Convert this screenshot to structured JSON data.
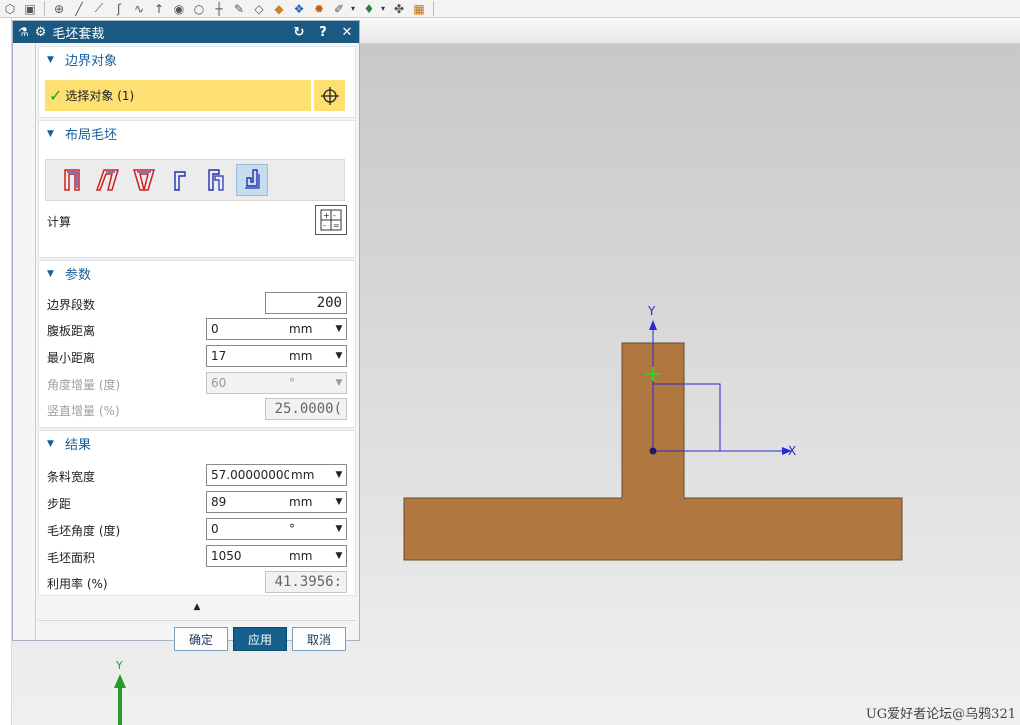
{
  "toolbar": {
    "icons": [
      "cube-icon",
      "cube-icon",
      "crosshair-icon",
      "line-icon",
      "line-icon",
      "curve-icon",
      "curve-icon",
      "arrow-up-icon",
      "circle-target-icon",
      "circle-icon",
      "cross-icon",
      "pen-icon",
      "eraser-icon",
      "brush-icon",
      "layers-icon",
      "gear-icon",
      "ruler-icon",
      "chart-icon",
      "camera-icon",
      "layout-icon"
    ]
  },
  "dialog": {
    "title": "毛坯套裁",
    "boundary": {
      "header": "边界对象",
      "select_label": "选择对象 (1)"
    },
    "layout": {
      "header": "布局毛坯",
      "calc_label": "计算"
    },
    "params": {
      "header": "参数",
      "boundary_segments": {
        "label": "边界段数",
        "value": "200"
      },
      "web_distance": {
        "label": "腹板距离",
        "value": "0",
        "unit": "mm"
      },
      "min_distance": {
        "label": "最小距离",
        "value": "17",
        "unit": "mm"
      },
      "angle_increment": {
        "label": "角度增量 (度)",
        "value": "60",
        "unit": "°"
      },
      "vertical_increment": {
        "label": "竖直增量 (%)",
        "value": "25.0000("
      }
    },
    "results": {
      "header": "结果",
      "strip_width": {
        "label": "条料宽度",
        "value": "57.00000000",
        "unit": "mm"
      },
      "pitch": {
        "label": "步距",
        "value": "89",
        "unit": "mm"
      },
      "blank_angle": {
        "label": "毛坯角度 (度)",
        "value": "0",
        "unit": "°"
      },
      "blank_area": {
        "label": "毛坯面积",
        "value": "1050",
        "unit": "mm"
      },
      "utilization": {
        "label": "利用率 (%)",
        "value": "41.3956:"
      }
    },
    "buttons": {
      "ok": "确定",
      "apply": "应用",
      "cancel": "取消"
    }
  },
  "viewport": {
    "axis_x": "X",
    "axis_y": "Y",
    "triad_y": "Y",
    "part_color": "#b07840",
    "watermark": "UG爱好者论坛@乌鸦321"
  }
}
